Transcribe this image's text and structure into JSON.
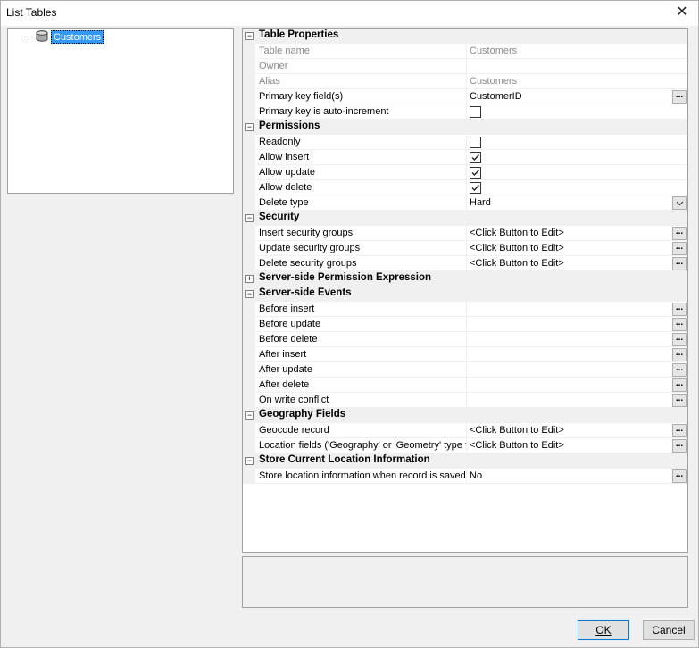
{
  "window": {
    "title": "List Tables"
  },
  "tree": {
    "node_label": "Customers",
    "icon": "database-table-icon"
  },
  "grid": {
    "rows": [
      {
        "type": "cat",
        "expanded": true,
        "label": "Table Properties"
      },
      {
        "type": "prop",
        "name": "Table name",
        "value": "Customers",
        "disabled": true
      },
      {
        "type": "prop",
        "name": "Owner",
        "value": "",
        "disabled": true
      },
      {
        "type": "prop",
        "name": "Alias",
        "value": "Customers",
        "disabled": true
      },
      {
        "type": "prop",
        "name": "Primary key field(s)",
        "value": "CustomerID",
        "editor": "ellipsis"
      },
      {
        "type": "prop",
        "name": "Primary key is auto-increment",
        "editor": "checkbox",
        "checked": false
      },
      {
        "type": "cat",
        "expanded": true,
        "label": "Permissions"
      },
      {
        "type": "prop",
        "name": "Readonly",
        "editor": "checkbox",
        "checked": false
      },
      {
        "type": "prop",
        "name": "Allow insert",
        "editor": "checkbox",
        "checked": true
      },
      {
        "type": "prop",
        "name": "Allow update",
        "editor": "checkbox",
        "checked": true
      },
      {
        "type": "prop",
        "name": "Allow delete",
        "editor": "checkbox",
        "checked": true
      },
      {
        "type": "prop",
        "name": "Delete type",
        "value": "Hard",
        "editor": "dropdown"
      },
      {
        "type": "cat",
        "expanded": true,
        "label": "Security"
      },
      {
        "type": "prop",
        "name": "Insert security groups",
        "value": "<Click Button to Edit>",
        "editor": "ellipsis"
      },
      {
        "type": "prop",
        "name": "Update security groups",
        "value": "<Click Button to Edit>",
        "editor": "ellipsis"
      },
      {
        "type": "prop",
        "name": "Delete security groups",
        "value": "<Click Button to Edit>",
        "editor": "ellipsis"
      },
      {
        "type": "cat",
        "expanded": false,
        "label": "Server-side Permission Expression"
      },
      {
        "type": "cat",
        "expanded": true,
        "label": "Server-side Events"
      },
      {
        "type": "prop",
        "name": "Before insert",
        "value": "",
        "editor": "ellipsis"
      },
      {
        "type": "prop",
        "name": "Before update",
        "value": "",
        "editor": "ellipsis"
      },
      {
        "type": "prop",
        "name": "Before delete",
        "value": "",
        "editor": "ellipsis"
      },
      {
        "type": "prop",
        "name": "After insert",
        "value": "",
        "editor": "ellipsis"
      },
      {
        "type": "prop",
        "name": "After update",
        "value": "",
        "editor": "ellipsis"
      },
      {
        "type": "prop",
        "name": "After delete",
        "value": "",
        "editor": "ellipsis"
      },
      {
        "type": "prop",
        "name": "On write conflict",
        "value": "",
        "editor": "ellipsis"
      },
      {
        "type": "cat",
        "expanded": true,
        "label": "Geography Fields"
      },
      {
        "type": "prop",
        "name": "Geocode record",
        "value": "<Click Button to Edit>",
        "editor": "ellipsis"
      },
      {
        "type": "prop",
        "name": "Location fields ('Geography' or 'Geometry' type fiel",
        "value": "<Click Button to Edit>",
        "editor": "ellipsis"
      },
      {
        "type": "cat",
        "expanded": true,
        "label": "Store Current Location Information"
      },
      {
        "type": "prop",
        "name": "Store location information when record is saved",
        "value": "No",
        "editor": "ellipsis"
      }
    ]
  },
  "buttons": {
    "ok_label": "OK",
    "cancel_label": "Cancel"
  }
}
